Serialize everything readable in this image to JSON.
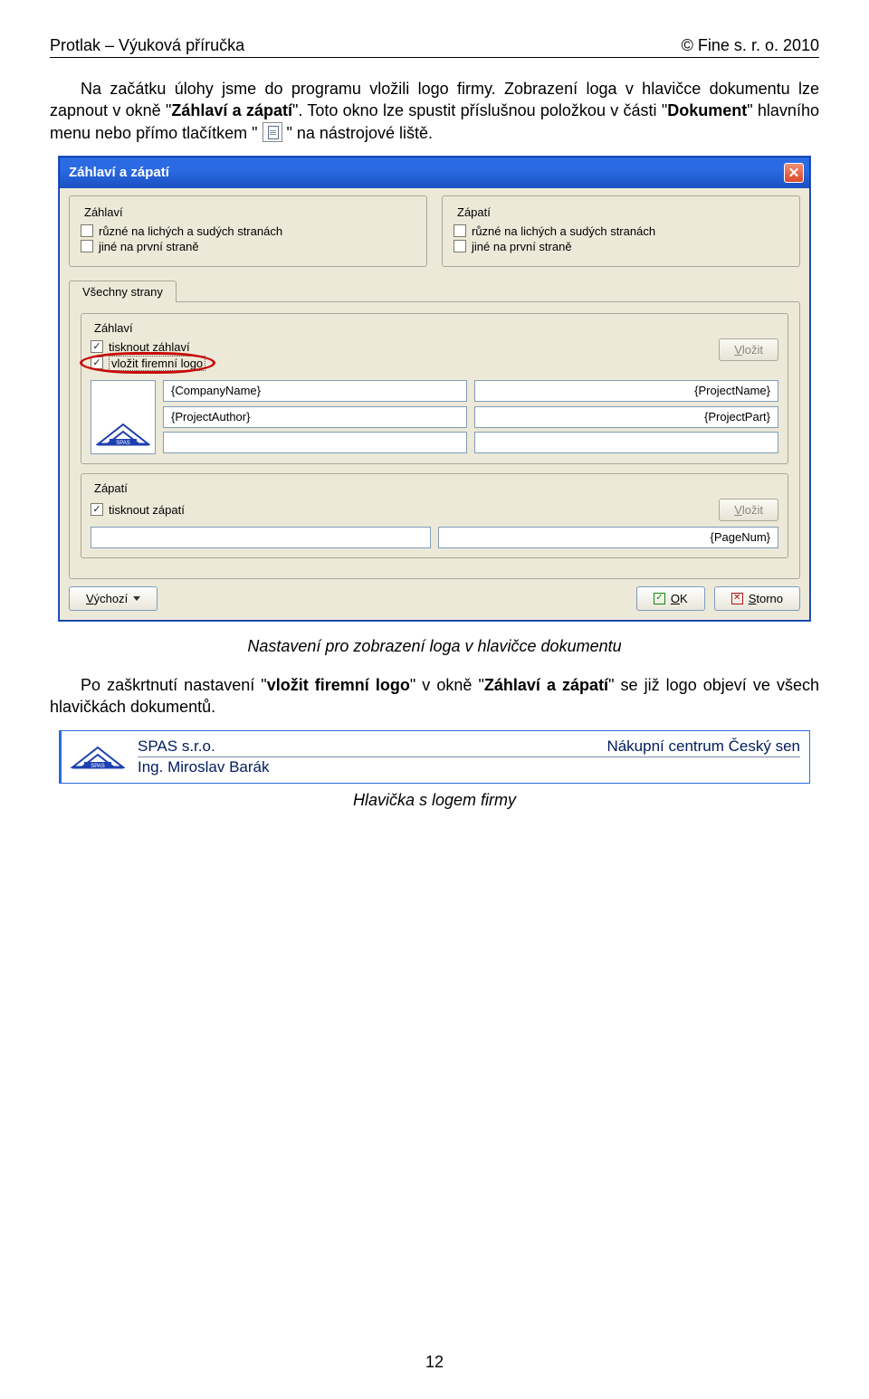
{
  "header": {
    "left": "Protlak – Výuková příručka",
    "right": "© Fine s. r. o. 2010"
  },
  "para1": {
    "t1": "Na začátku úlohy jsme do programu vložili logo firmy. Zobrazení loga v hlavičce dokumentu lze zapnout v okně \"",
    "b1": "Záhlaví a zápatí",
    "t2": "\". Toto okno lze spustit příslušnou položkou v části \"",
    "b2": "Dokument",
    "t3": "\" hlavního menu nebo přímo tlačítkem \" ",
    "t4": " \" na nástrojové liště."
  },
  "dialog": {
    "title": "Záhlaví a zápatí",
    "zahlavi": "Záhlaví",
    "zapati": "Zápatí",
    "chk_ruzne": "různé na lichých a sudých stranách",
    "chk_jine": "jiné na první straně",
    "tab": "Všechny strany",
    "chk_tisknout_zahlavi": "tisknout záhlaví",
    "chk_vlozit_logo": "vložit firemní logo",
    "btn_vlozit": "Vložit",
    "field_company": "{CompanyName}",
    "field_project": "{ProjectName}",
    "field_author": "{ProjectAuthor}",
    "field_part": "{ProjectPart}",
    "chk_tisknout_zapati": "tisknout zápatí",
    "field_pagenum": "{PageNum}",
    "btn_vychozi": "Výchozí",
    "btn_ok": "OK",
    "btn_storno": "Storno"
  },
  "caption1": "Nastavení pro zobrazení loga v hlavičce dokumentu",
  "para2": {
    "t1": "Po zaškrtnutí nastavení \"",
    "b1": "vložit firemní logo",
    "t2": "\" v okně \"",
    "b2": "Záhlaví a zápatí",
    "t3": "\" se již logo objeví ve všech hlavičkách dokumentů."
  },
  "sample": {
    "company": "SPAS s.r.o.",
    "project": "Nákupní centrum Český sen",
    "author": "Ing. Miroslav Barák"
  },
  "caption2": "Hlavička s logem firmy",
  "pagenum": "12"
}
